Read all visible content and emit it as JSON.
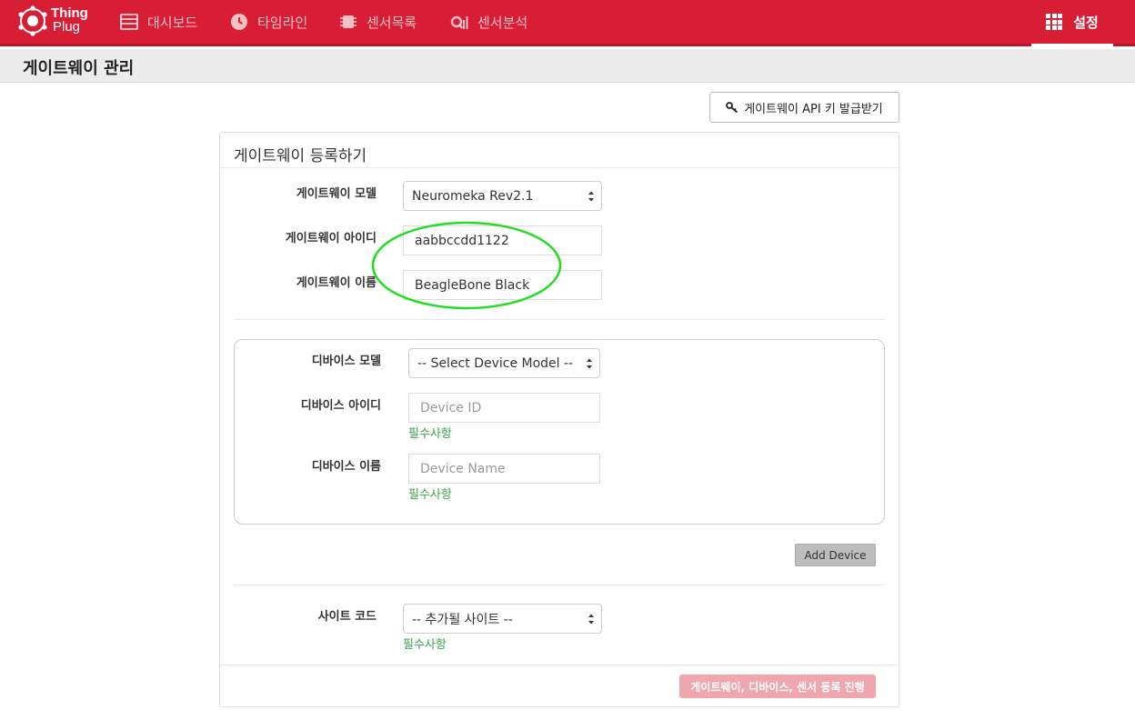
{
  "brand": {
    "line1": "Thing",
    "line2": "Plug"
  },
  "nav": {
    "items": [
      {
        "label": "대시보드",
        "icon": "dashboard-icon"
      },
      {
        "label": "타임라인",
        "icon": "clock-icon"
      },
      {
        "label": "센서목록",
        "icon": "chip-icon"
      },
      {
        "label": "센서분석",
        "icon": "analytics-icon"
      }
    ],
    "settings": {
      "label": "설정",
      "icon": "grid-icon"
    }
  },
  "page": {
    "title": "게이트웨이 관리"
  },
  "apikey": {
    "label": "게이트웨이 API 키 발급받기",
    "icon": "key-icon"
  },
  "panel": {
    "title": "게이트웨이 등록하기"
  },
  "gateway": {
    "model_label": "게이트웨이 모델",
    "model_value": "Neuromeka Rev2.1",
    "id_label": "게이트웨이 아이디",
    "id_value": "aabbccdd1122",
    "name_label": "게이트웨이 이름",
    "name_value": "BeagleBone Black"
  },
  "device": {
    "model_label": "디바이스 모델",
    "model_value": "-- Select Device Model --",
    "id_label": "디바이스 아이디",
    "id_placeholder": "Device ID",
    "id_help": "필수사항",
    "name_label": "디바이스 이름",
    "name_placeholder": "Device Name",
    "name_help": "필수사항",
    "add_button": "Add Device"
  },
  "site": {
    "label": "사이트 코드",
    "value": "-- 추가될 사이트 --",
    "help": "필수사항"
  },
  "submit": {
    "label": "게이트웨이, 디바이스, 센서 등록 진행"
  },
  "colors": {
    "brand_red": "#d81e35",
    "help_green": "#3aa54b",
    "annotation_green": "#22dd22",
    "submit_disabled": "#f0a6af"
  }
}
